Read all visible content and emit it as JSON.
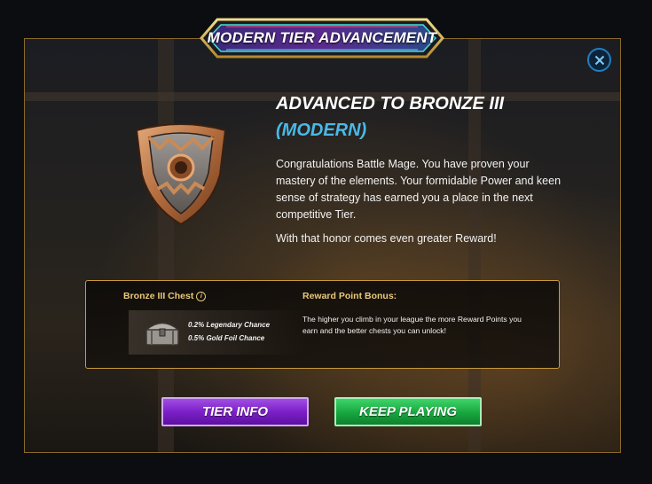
{
  "modal": {
    "title": "MODERN TIER ADVANCEMENT",
    "close_icon": "close-icon"
  },
  "advancement": {
    "heading": "ADVANCED TO BRONZE III",
    "subheading": "(MODERN)",
    "shield_icon": "bronze-shield-icon",
    "message": "Congratulations Battle Mage. You have proven your mastery of the elements. Your formidable Power and keen sense of strategy has earned you a place in the next competitive Tier.",
    "message2": "With that honor comes even greater Reward!"
  },
  "reward": {
    "chest_title": "Bronze III Chest",
    "info_icon": "i",
    "chest_icon": "chest-icon",
    "legendary_chance": "0.2% Legendary Chance",
    "gold_foil_chance": "0.5% Gold Foil Chance",
    "bonus_title": "Reward Point Bonus:",
    "bonus_text": "The higher you climb in your league the more Reward Points you earn and the better chests you can unlock!"
  },
  "buttons": {
    "tier_info": "TIER INFO",
    "keep_playing": "KEEP PLAYING"
  },
  "colors": {
    "accent_gold": "#c89a3c",
    "subheading_blue": "#49b9e8",
    "tier_button_purple": "#7c1fc9",
    "play_button_green": "#17a63e",
    "close_button_blue": "#1f7fc0"
  }
}
